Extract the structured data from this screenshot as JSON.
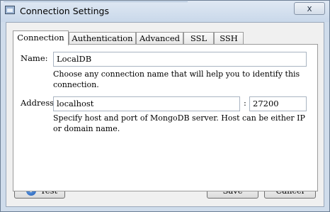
{
  "window": {
    "title": "Connection Settings",
    "close_glyph": "x"
  },
  "tabs": [
    {
      "label": "Connection",
      "active": true
    },
    {
      "label": "Authentication",
      "active": false
    },
    {
      "label": "Advanced",
      "active": false
    },
    {
      "label": "SSL",
      "active": false
    },
    {
      "label": "SSH",
      "active": false
    }
  ],
  "connection": {
    "name_label": "Name:",
    "name_value": "LocalDB",
    "name_hint": "Choose any connection name that will help you to identify this connection.",
    "address_label": "Address:",
    "host_value": "localhost",
    "port_separator": ":",
    "port_value": "27200",
    "address_hint": "Specify host and port of MongoDB server. Host can be either IP or domain name."
  },
  "buttons": {
    "test": "Test",
    "save": "Save",
    "cancel": "Cancel"
  },
  "icons": {
    "test_icon": "info-icon",
    "info_glyph": "i",
    "app_icon": "window-icon",
    "close_icon": "close-icon"
  }
}
